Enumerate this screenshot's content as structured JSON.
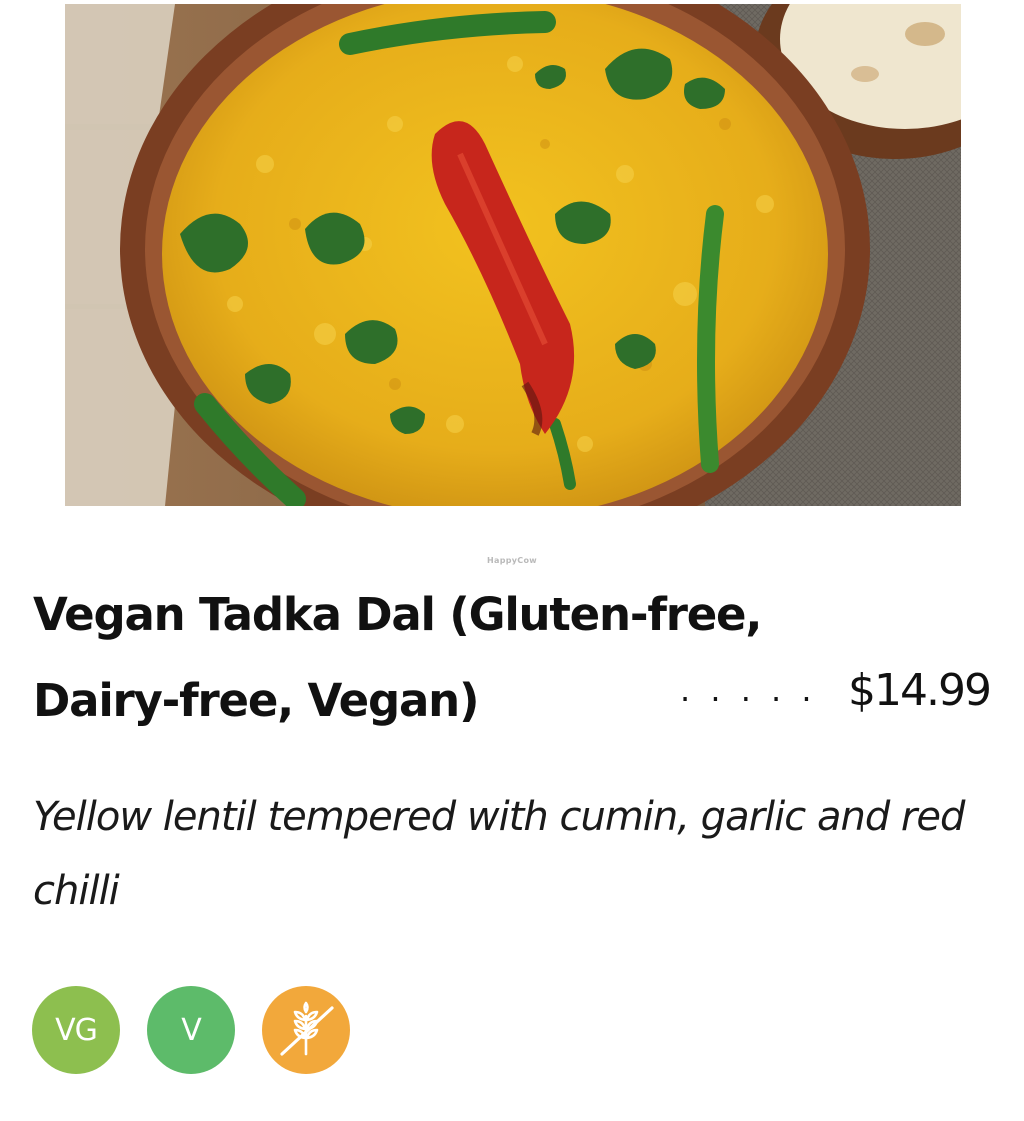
{
  "menu_item": {
    "name": "Vegan Tadka Dal (Gluten-free, Dairy-free, Vegan)",
    "price_dots": ". . . . .",
    "price": "$14.99",
    "description": "Yellow lentil tempered with cumin, garlic and red chilli"
  },
  "watermark": "HappyCow",
  "badges": [
    {
      "label": "VG",
      "icon": "vegan-badge",
      "color": "#8dbf4f"
    },
    {
      "label": "V",
      "icon": "vegetarian-badge",
      "color": "#5dbb6a"
    },
    {
      "label": "",
      "icon": "gluten-free-wheat-crossed-icon",
      "color": "#f2a83b"
    }
  ],
  "colors": {
    "dal": "#e8b21d",
    "bowl": "#7a3e22",
    "chilli": "#c7261c",
    "herb": "#2f7a2a"
  }
}
